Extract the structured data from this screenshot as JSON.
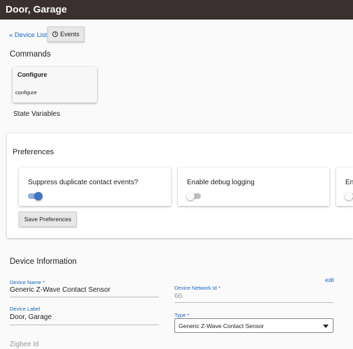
{
  "header": {
    "title": "Door, Garage"
  },
  "toolbar": {
    "device_list_link": "« Device List",
    "events_button": "Events",
    "info_glyph": "i"
  },
  "commands": {
    "heading": "Commands",
    "card_title": "Configure",
    "card_command": "configure"
  },
  "state_variables": {
    "heading": "State Variables"
  },
  "preferences": {
    "heading": "Preferences",
    "items": [
      {
        "label": "Suppress duplicate contact events?",
        "enabled": true
      },
      {
        "label": "Enable debug logging",
        "enabled": false
      },
      {
        "label": "En",
        "enabled": false
      }
    ],
    "save_button": "Save Preferences"
  },
  "device_information": {
    "heading": "Device Information",
    "device_name_label": "Device Name *",
    "device_name_value": "Generic Z-Wave Contact Sensor",
    "device_network_id_label": "Device Network Id *",
    "device_network_id_value": "66",
    "edit_link": "edit",
    "device_label_label": "Device Label",
    "device_label_value": "Door, Garage",
    "type_label": "Type *",
    "type_value": "Generic Z-Wave Contact Sensor",
    "zigbee_id_placeholder": "Zigbee Id"
  },
  "colors": {
    "header_bg": "#3a3030",
    "link": "#1565c0",
    "toggle_on": "#3f73c8"
  }
}
